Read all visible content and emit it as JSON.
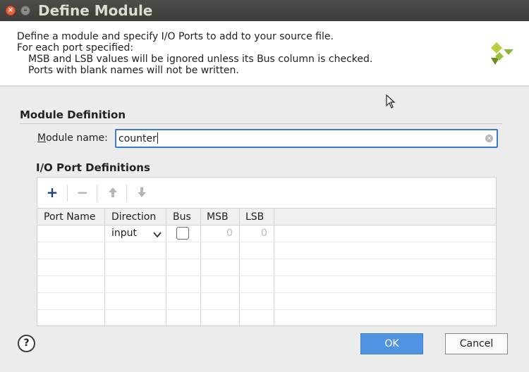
{
  "window": {
    "title": "Define Module"
  },
  "header": {
    "lines": [
      "Define a module and specify I/O Ports to add to your source file.",
      "For each port specified:",
      "MSB and LSB values will be ignored unless its Bus column is checked.",
      "Ports with blank names will not be written."
    ],
    "logo_icon": "xilinx-logo-icon"
  },
  "module_definition": {
    "title": "Module Definition",
    "name_label": "Module name:",
    "name_value": "counter"
  },
  "io_ports": {
    "title": "I/O Port Definitions",
    "toolbar": {
      "add_icon": "plus-icon",
      "remove_icon": "minus-icon",
      "up_icon": "arrow-up-icon",
      "down_icon": "arrow-down-icon"
    },
    "columns": [
      "Port Name",
      "Direction",
      "Bus",
      "MSB",
      "LSB"
    ],
    "rows": [
      {
        "port_name": "",
        "direction": "input",
        "bus": false,
        "msb": "0",
        "lsb": "0"
      }
    ],
    "empty_rows": 5
  },
  "footer": {
    "help_label": "?",
    "ok_label": "OK",
    "cancel_label": "Cancel"
  },
  "colors": {
    "titlebar": "#3c3b37",
    "accent_focus": "#3d7ad1",
    "ok_button": "#5193e3",
    "close_button": "#e9643c",
    "logo_green": "#8db63c"
  }
}
